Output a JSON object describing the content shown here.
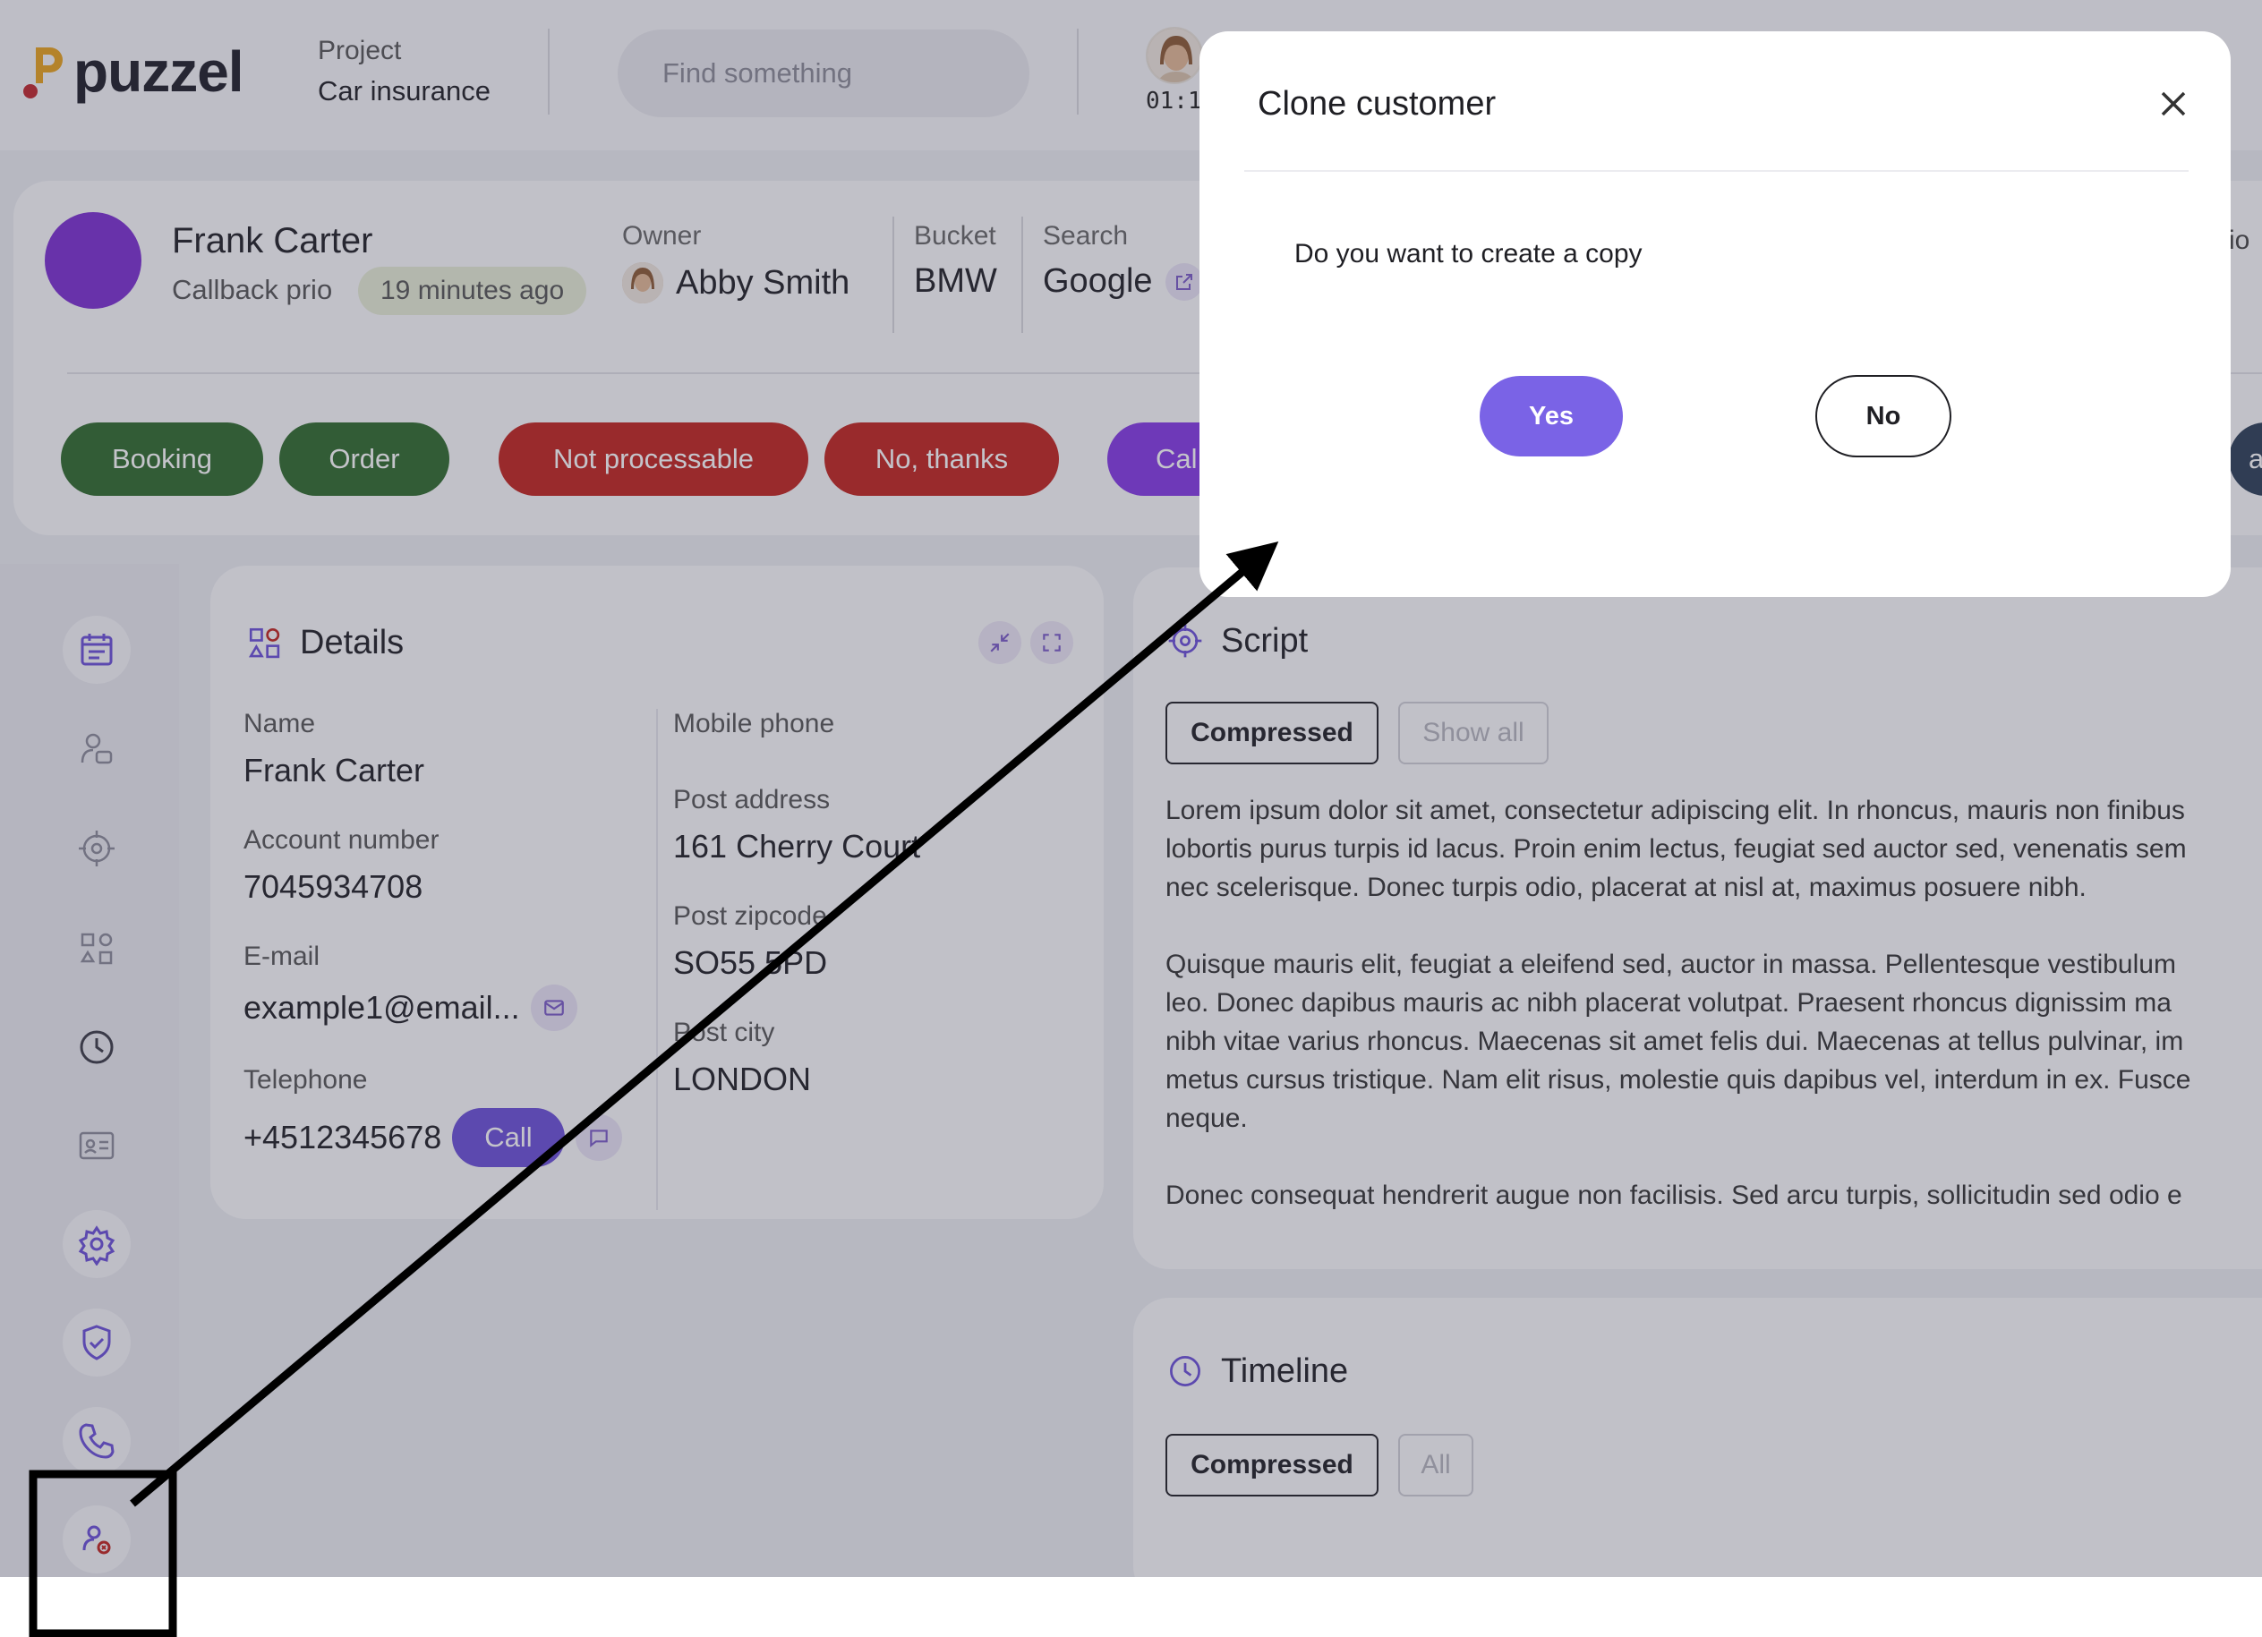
{
  "app": {
    "logo_text": "puzzel",
    "project_label": "Project",
    "project_value": "Car insurance",
    "search_placeholder": "Find something",
    "agent_timer": "01:1"
  },
  "customer": {
    "name": "Frank Carter",
    "prio_label": "Callback prio",
    "prio_time": "19 minutes ago",
    "owner_label": "Owner",
    "owner_value": "Abby Smith",
    "bucket_label": "Bucket",
    "bucket_value": "BMW",
    "search_label": "Search",
    "search_value": "Google",
    "peek_right": "io"
  },
  "actions": {
    "booking": "Booking",
    "order": "Order",
    "not_processable": "Not processable",
    "no_thanks": "No, thanks",
    "call_peek": "Cal",
    "right_peek": "ac"
  },
  "details": {
    "title": "Details",
    "name_label": "Name",
    "name_value": "Frank Carter",
    "account_label": "Account number",
    "account_value": "7045934708",
    "email_label": "E-mail",
    "email_value": "example1@email...",
    "telephone_label": "Telephone",
    "telephone_value": "+4512345678",
    "call_button": "Call",
    "mobile_label": "Mobile phone",
    "mobile_value": "",
    "post_address_label": "Post address",
    "post_address_value": "161 Cherry Court",
    "post_zip_label": "Post zipcode",
    "post_zip_value": "SO55 5PD",
    "post_city_label": "Post city",
    "post_city_value": "LONDON"
  },
  "script": {
    "title": "Script",
    "tab_compressed": "Compressed",
    "tab_show_all": "Show all",
    "paragraphs": [
      [
        "Lorem ipsum dolor sit amet, consectetur adipiscing elit. In rhoncus, mauris non finibus",
        "lobortis purus turpis id lacus. Proin enim lectus, feugiat sed auctor sed, venenatis sem",
        "nec scelerisque. Donec turpis odio, placerat at nisl at, maximus posuere nibh."
      ],
      [
        "Quisque mauris elit, feugiat a eleifend sed, auctor in massa. Pellentesque vestibulum",
        "leo. Donec dapibus mauris ac nibh placerat volutpat. Praesent rhoncus dignissim ma",
        "nibh vitae varius rhoncus. Maecenas sit amet felis dui. Maecenas at tellus pulvinar, im",
        "metus cursus tristique. Nam elit risus, molestie quis dapibus vel, interdum in ex. Fusce",
        "neque."
      ],
      [
        "Donec consequat hendrerit augue non facilisis. Sed arcu turpis, sollicitudin sed odio e"
      ]
    ]
  },
  "timeline": {
    "title": "Timeline",
    "tab_compressed": "Compressed",
    "tab_all": "All"
  },
  "modal": {
    "title": "Clone customer",
    "message": "Do you want to create a copy",
    "yes": "Yes",
    "no": "No"
  },
  "colors": {
    "primary_purple": "#7a63e6",
    "green_action": "#2f6b2b",
    "red_action": "#c2231d",
    "purple_action": "#8438e6",
    "avatar_purple": "#7c2ed2"
  },
  "icons": {
    "nav": [
      "calendar-icon",
      "user-chat-icon",
      "target-icon",
      "shapes-icon",
      "clock-icon",
      "contact-card-icon",
      "gear-icon",
      "shield-check-icon",
      "phone-icon",
      "user-clone-icon"
    ]
  }
}
